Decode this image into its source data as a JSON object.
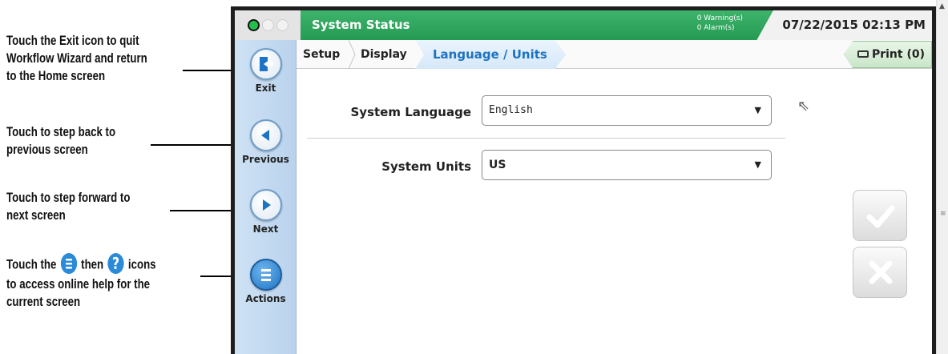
{
  "callouts": {
    "exit": [
      "Touch the Exit icon to quit",
      "Workflow Wizard and return",
      "to the Home screen"
    ],
    "previous": [
      "Touch to step back to",
      "previous screen"
    ],
    "next": [
      "Touch to step forward to",
      "next screen"
    ],
    "actions": {
      "prefix": "Touch the",
      "middle": "then",
      "suffix": "icons",
      "line2": "to access online help for the",
      "line3": "current screen"
    }
  },
  "header": {
    "status_title": "System Status",
    "warnings": "0 Warning(s)",
    "alarms": "0 Alarm(s)",
    "datetime": "07/22/2015 02:13 PM",
    "status_color": "#2ea85c"
  },
  "breadcrumb": {
    "items": [
      "Setup",
      "Display"
    ],
    "active": "Language / Units"
  },
  "print": {
    "label": "Print (0)"
  },
  "sidenav": {
    "exit": "Exit",
    "previous": "Previous",
    "next": "Next",
    "actions": "Actions"
  },
  "form": {
    "language_label": "System Language",
    "language_value": "English",
    "units_label": "System Units",
    "units_value": "US"
  },
  "icons": {
    "exit": "exit-door-icon",
    "previous": "left-arrow-icon",
    "next": "right-arrow-icon",
    "actions": "menu-lines-icon",
    "help": "question-mark-icon",
    "print": "printer-icon",
    "confirm": "checkmark-icon",
    "cancel": "x-icon"
  }
}
